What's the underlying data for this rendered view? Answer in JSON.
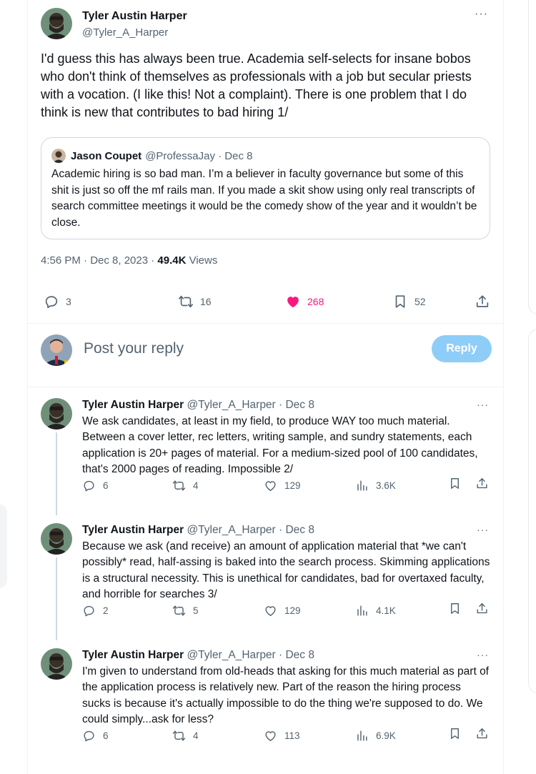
{
  "main_tweet": {
    "author_name": "Tyler Austin Harper",
    "author_handle": "@Tyler_A_Harper",
    "more_label": "···",
    "text": "I'd guess this has always been true. Academia self-selects for insane bobos who don't think of themselves as professionals with a job but secular priests with a vocation. (I like this! Not a complaint). There is one problem that I do think is new that contributes to bad hiring 1/",
    "quoted": {
      "author_name": "Jason Coupet",
      "author_handle_date": "@ProfessaJay · Dec 8",
      "text": "Academic hiring is so bad man. I’m a believer in faculty governance but some of this shit is just so off the mf rails man. If you made a skit show using only real transcripts of search committee meetings it would be the comedy show of the year and it wouldn’t be close."
    },
    "timestamp": "4:56 PM · Dec 8, 2023 · ",
    "views_count": "49.4K",
    "views_label": " Views",
    "stats": {
      "replies": "3",
      "reposts": "16",
      "likes": "268",
      "bookmarks": "52"
    }
  },
  "reply_composer": {
    "placeholder": "Post your reply",
    "button_label": "Reply"
  },
  "replies": [
    {
      "author_name": "Tyler Austin Harper",
      "author_handle_date": "@Tyler_A_Harper · Dec 8",
      "text": "We ask candidates, at least in my field, to produce WAY too much material. Between a cover letter, rec letters, writing sample, and sundry statements, each application is 20+ pages of material. For a medium-sized pool of 100 candidates, that's 2000 pages of reading. Impossible 2/",
      "replies": "6",
      "reposts": "4",
      "likes": "129",
      "views": "3.6K"
    },
    {
      "author_name": "Tyler Austin Harper",
      "author_handle_date": "@Tyler_A_Harper · Dec 8",
      "text": "Because we ask (and receive) an amount of application material that *we can't possibly* read, half-assing is baked into the search process. Skimming applications is a structural necessity. This is unethical for candidates, bad for overtaxed faculty, and horrible for searches 3/",
      "replies": "2",
      "reposts": "5",
      "likes": "129",
      "views": "4.1K"
    },
    {
      "author_name": "Tyler Austin Harper",
      "author_handle_date": "@Tyler_A_Harper · Dec 8",
      "text": "I'm given to understand from old-heads that asking for this much material as part of the application process is relatively new. Part of the reason the hiring process sucks is because it's actually impossible to do the thing we're supposed to do. We could simply...ask for less?",
      "replies": "6",
      "reposts": "4",
      "likes": "113",
      "views": "6.9K"
    }
  ],
  "colors": {
    "text": "#0f1419",
    "secondary": "#536471",
    "like": "#f91880",
    "reply_button": "#8ecdf7",
    "border": "#eff3f4"
  },
  "icons": [
    "reply-icon",
    "repost-icon",
    "heart-icon",
    "bookmark-icon",
    "share-icon",
    "views-icon",
    "more-icon"
  ]
}
